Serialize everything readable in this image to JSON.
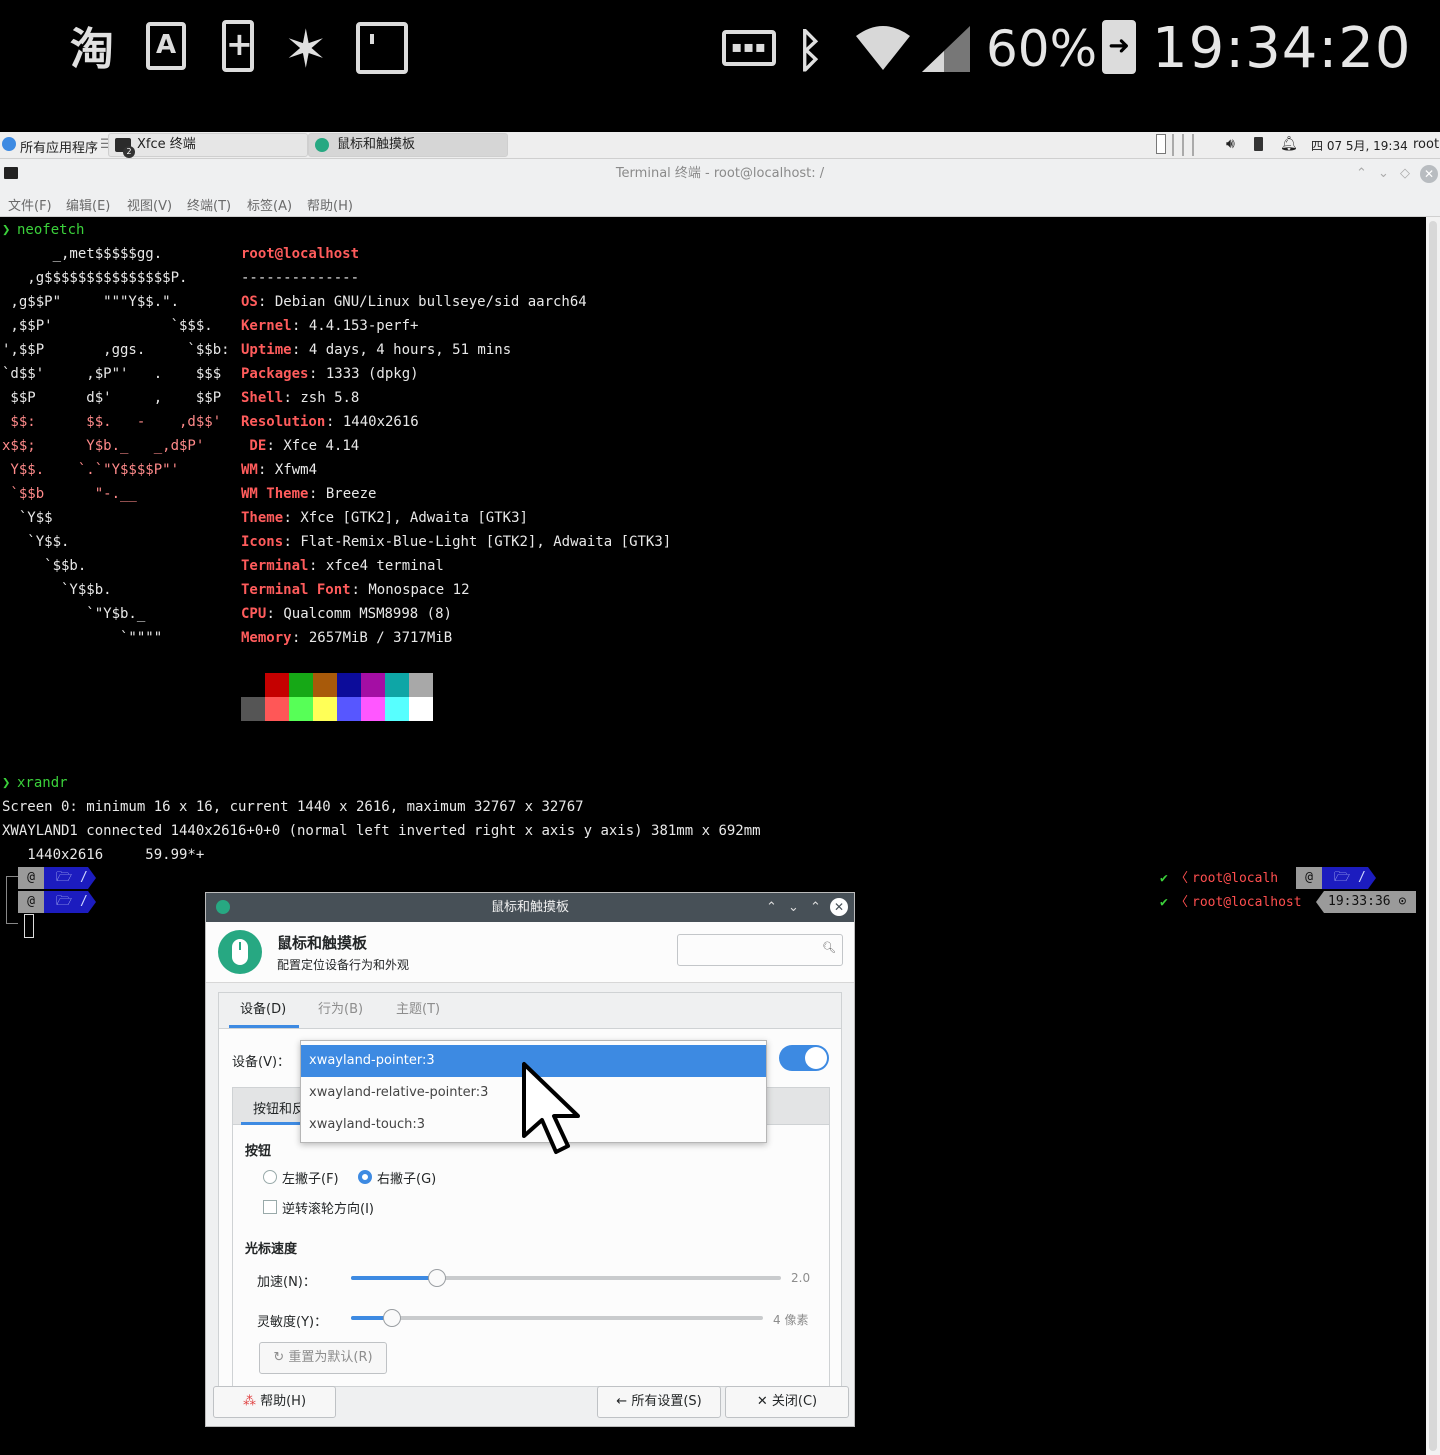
{
  "status_bar": {
    "battery_percent": "60%",
    "time": "19:34:20",
    "left_icons": [
      "taobao-icon",
      "font-icon",
      "battery-saver-icon",
      "sparkle-icon",
      "screenshot-icon"
    ],
    "right_icons": [
      "keyboard-icon",
      "bluetooth-icon",
      "wifi-icon",
      "cell-signal-icon",
      "battery-charging-icon"
    ]
  },
  "panel": {
    "apps_menu": "所有应用程序",
    "tasks": [
      {
        "label": "Xfce 终端",
        "badge": "2"
      },
      {
        "label": "鼠标和触摸板"
      }
    ],
    "datetime": "四 07 5月, 19:34",
    "user": "root"
  },
  "terminal": {
    "title": "Terminal 终端 - root@localhost: /",
    "menu": [
      "文件(F)",
      "编辑(E)",
      "视图(V)",
      "终端(T)",
      "标签(A)",
      "帮助(H)"
    ],
    "cmd1": "neofetch",
    "ascii": [
      "      _,met$$$$$gg.",
      "   ,g$$$$$$$$$$$$$$$P.",
      " ,g$$P\"     \"\"\"Y$$.\".",
      " ,$$P'              `$$$.",
      "',$$P       ,ggs.     `$$b:",
      "`d$$'     ,$P\"'   .    $$$",
      " $$P      d$'     ,    $$P",
      " $$:      $$.   -    ,d$$'",
      "x$$;      Y$b._   _,d$P'",
      " Y$$.    `.`\"Y$$$$P\"'",
      " `$$b      \"-.__",
      "  `Y$$",
      "   `Y$$.",
      "     `$$b.",
      "       `Y$$b.",
      "          `\"Y$b._",
      "              `\"\"\"\""
    ],
    "user_host": "root@localhost",
    "separator": "--------------",
    "info": [
      {
        "key": "OS",
        "value": "Debian GNU/Linux bullseye/sid aarch64"
      },
      {
        "key": "Kernel",
        "value": "4.4.153-perf+"
      },
      {
        "key": "Uptime",
        "value": "4 days, 4 hours, 51 mins"
      },
      {
        "key": "Packages",
        "value": "1333 (dpkg)"
      },
      {
        "key": "Shell",
        "value": "zsh 5.8"
      },
      {
        "key": "Resolution",
        "value": "1440x2616"
      },
      {
        "key": " DE",
        "value": "Xfce 4.14"
      },
      {
        "key": "WM",
        "value": "Xfwm4"
      },
      {
        "key": "WM Theme",
        "value": "Breeze"
      },
      {
        "key": "Theme",
        "value": "Xfce [GTK2], Adwaita [GTK3]"
      },
      {
        "key": "Icons",
        "value": "Flat-Remix-Blue-Light [GTK2], Adwaita [GTK3]"
      },
      {
        "key": "Terminal",
        "value": "xfce4 terminal"
      },
      {
        "key": "Terminal Font",
        "value": "Monospace 12"
      },
      {
        "key": "CPU",
        "value": "Qualcomm MSM8998 (8)"
      },
      {
        "key": "Memory",
        "value": "2657MiB / 3717MiB"
      }
    ],
    "palette_row1": [
      "#000000",
      "#c50000",
      "#16a816",
      "#a85a0a",
      "#0c0c9a",
      "#a40ea4",
      "#0ea6a6",
      "#a8a8a8"
    ],
    "palette_row2": [
      "#555555",
      "#ff5757",
      "#57ff57",
      "#ffff57",
      "#5757ff",
      "#ff57ff",
      "#57ffff",
      "#ffffff"
    ],
    "cmd2": "xrandr",
    "xrandr": [
      "Screen 0: minimum 16 x 16, current 1440 x 2616, maximum 32767 x 32767",
      "XWAYLAND1 connected 1440x2616+0+0 (normal left inverted right x axis y axis) 381mm x 692mm",
      "   1440x2616     59.99*+"
    ],
    "prompt_dir": "/",
    "right_prompt_1": "root@localh",
    "right_prompt_2": "root@localhost",
    "right_time": "19:33:36"
  },
  "dialog": {
    "title": "鼠标和触摸板",
    "header_title": "鼠标和触摸板",
    "header_subtitle": "配置定位设备行为和外观",
    "tabs": [
      "设备(D)",
      "行为(B)",
      "主题(T)"
    ],
    "device_label": "设备(V)：",
    "inner_tab": "按钮和反",
    "buttons_section": "按钮",
    "left_handed": "左撇子(F)",
    "right_handed": "右撇子(G)",
    "reverse_scroll": "逆转滚轮方向(I)",
    "pointer_speed_section": "光标速度",
    "accel_label": "加速(N)：",
    "accel_value": "2.0",
    "accel_fraction": 0.2,
    "sensitivity_label": "灵敏度(Y)：",
    "sensitivity_value": "4 像素",
    "sensitivity_fraction": 0.1,
    "reset_button": "重置为默认(R)",
    "help_button": "帮助(H)",
    "all_settings_button": "所有设置(S)",
    "close_button": "关闭(C)",
    "device_options": [
      "xwayland-pointer:3",
      "xwayland-relative-pointer:3",
      "xwayland-touch:3"
    ],
    "selected_index": 0,
    "device_enabled": true
  }
}
